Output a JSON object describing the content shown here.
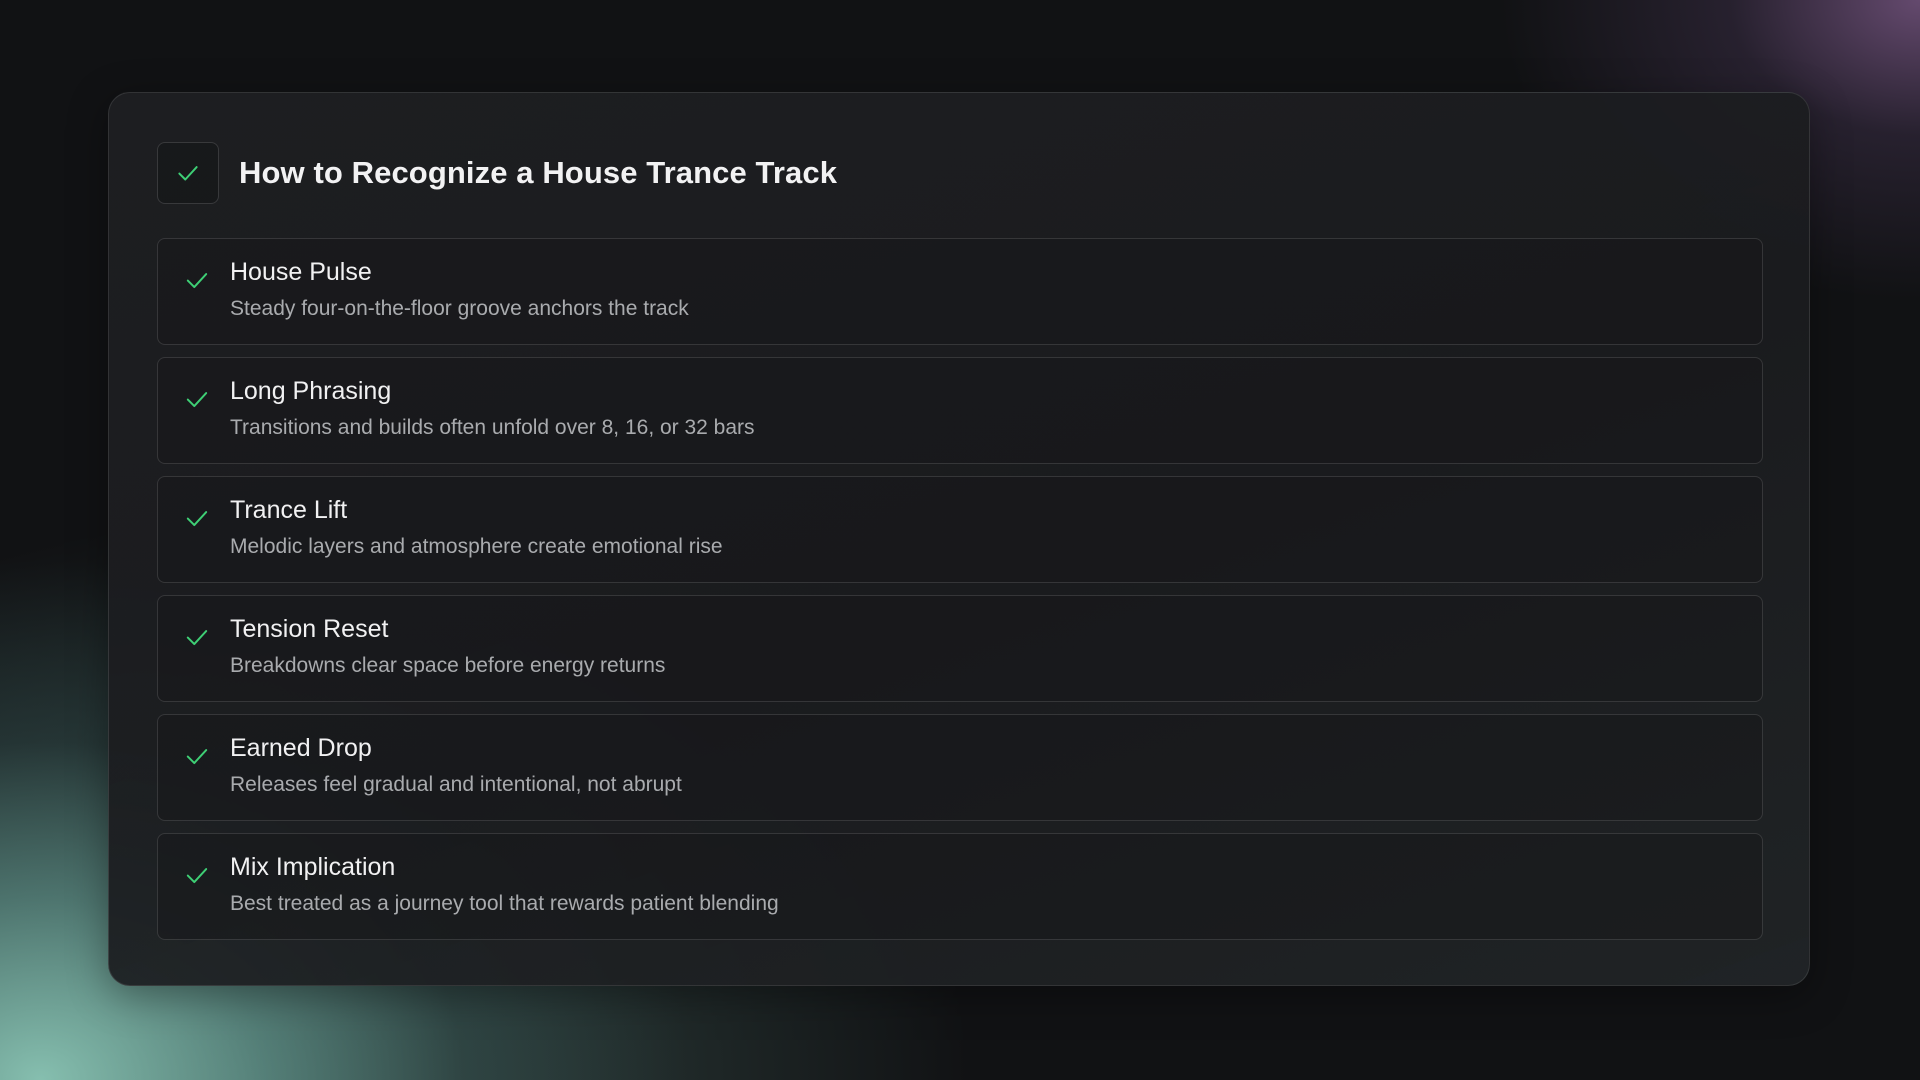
{
  "colors": {
    "accent": "#3ecf75",
    "title": "#f2f2f3",
    "description": "#a9abae"
  },
  "header": {
    "icon": "check-icon",
    "title": "How to Recognize a House Trance Track"
  },
  "items": [
    {
      "icon": "check-icon",
      "title": "House Pulse",
      "description": "Steady four-on-the-floor groove anchors the track"
    },
    {
      "icon": "check-icon",
      "title": "Long Phrasing",
      "description": "Transitions and builds often unfold over 8, 16, or 32 bars"
    },
    {
      "icon": "check-icon",
      "title": "Trance Lift",
      "description": "Melodic layers and atmosphere create emotional rise"
    },
    {
      "icon": "check-icon",
      "title": "Tension Reset",
      "description": "Breakdowns clear space before energy returns"
    },
    {
      "icon": "check-icon",
      "title": "Earned Drop",
      "description": "Releases feel gradual and intentional, not abrupt"
    },
    {
      "icon": "check-icon",
      "title": "Mix Implication",
      "description": "Best treated as a journey tool that rewards patient blending"
    }
  ]
}
